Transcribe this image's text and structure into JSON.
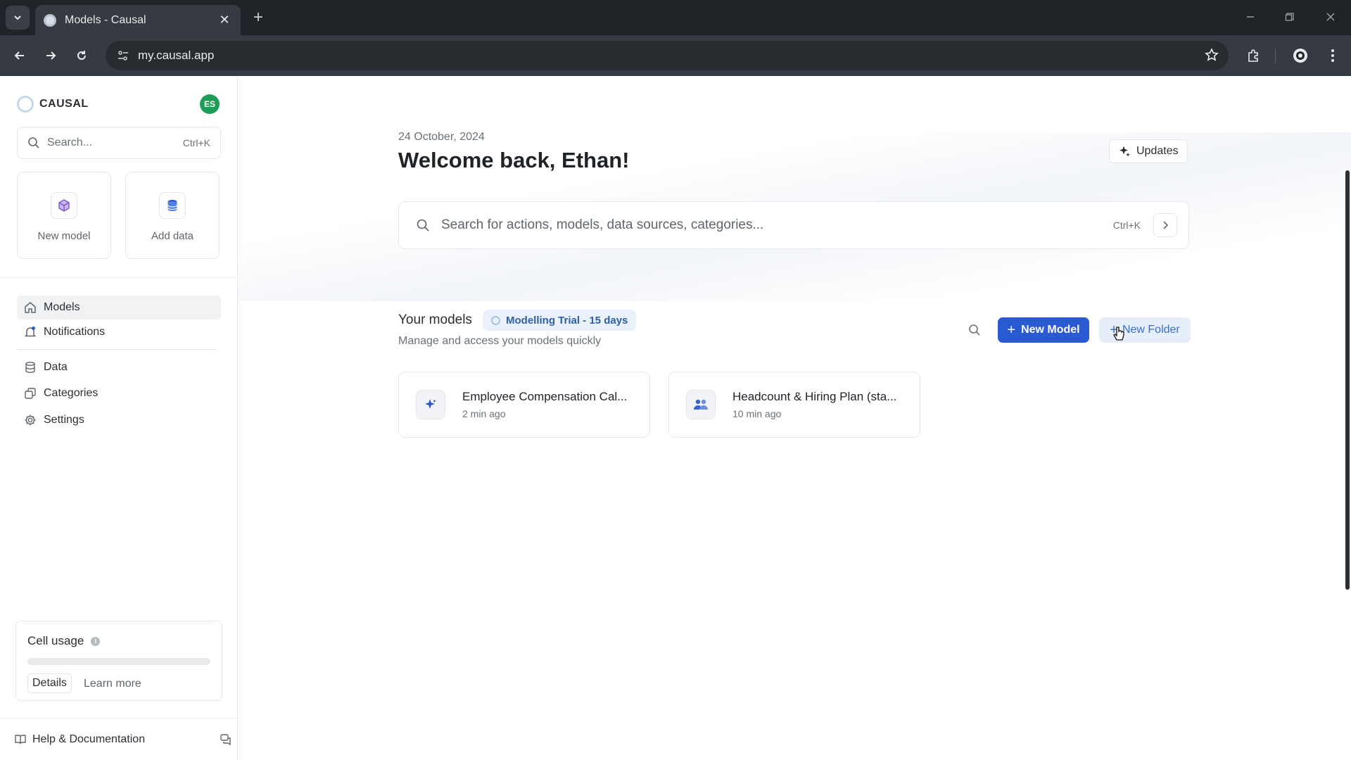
{
  "browser": {
    "tab_title": "Models - Causal",
    "url": "my.causal.app",
    "new_tab": "+",
    "close_tab": "✕"
  },
  "sidebar": {
    "brand": "CAUSAL",
    "avatar_initials": "ES",
    "search_placeholder": "Search...",
    "search_shortcut": "Ctrl+K",
    "quick_actions": [
      {
        "label": "New model",
        "icon": "cube-icon"
      },
      {
        "label": "Add data",
        "icon": "database-icon"
      }
    ],
    "nav": [
      {
        "label": "Models",
        "icon": "home-icon",
        "active": true
      },
      {
        "label": "Notifications",
        "icon": "bell-icon",
        "active": false
      },
      {
        "label": "Data",
        "icon": "database-icon",
        "active": false
      },
      {
        "label": "Categories",
        "icon": "copy-icon",
        "active": false
      },
      {
        "label": "Settings",
        "icon": "gear-icon",
        "active": false
      }
    ],
    "cell_usage": {
      "title": "Cell usage",
      "fraction_used": 0,
      "details_label": "Details",
      "learn_more_label": "Learn more"
    },
    "help_label": "Help & Documentation"
  },
  "main": {
    "date": "24 October, 2024",
    "welcome": "Welcome back, Ethan!",
    "updates_label": "Updates",
    "search_placeholder": "Search for actions, models, data sources, categories...",
    "search_shortcut": "Ctrl+K",
    "models_title": "Your models",
    "trial_badge": "Modelling Trial - 15 days",
    "models_subtitle": "Manage and access your models quickly",
    "new_model_label": "New Model",
    "new_folder_label": "New Folder",
    "models": [
      {
        "name": "Employee Compensation Cal...",
        "time": "2 min ago",
        "icon": "sparkle-icon"
      },
      {
        "name": "Headcount & Hiring Plan (sta...",
        "time": "10 min ago",
        "icon": "people-icon"
      }
    ]
  },
  "colors": {
    "accent": "#2a5ad2",
    "avatar": "#1f9d55",
    "badge_bg": "#eaf1fb",
    "chrome_dark": "#1f2428"
  }
}
